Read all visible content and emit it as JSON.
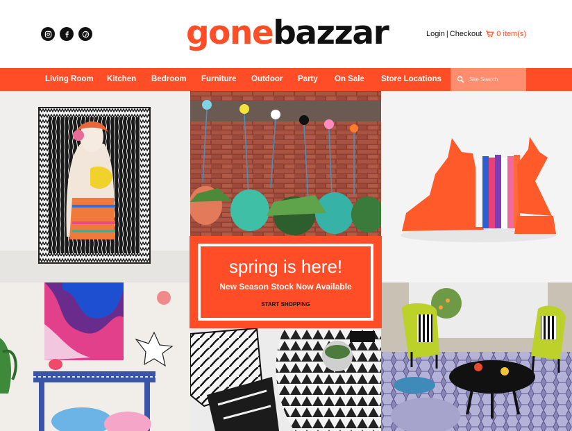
{
  "header": {
    "social": [
      {
        "name": "instagram-icon"
      },
      {
        "name": "facebook-icon"
      },
      {
        "name": "pinterest-icon"
      }
    ],
    "logo_part1": "gone",
    "logo_part2": "bazzar",
    "login_label": "Login",
    "separator": "|",
    "checkout_label": "Checkout",
    "cart_label": "0 item(s)"
  },
  "nav": {
    "items": [
      "Living Room",
      "Kitchen",
      "Bedroom",
      "Furniture",
      "Outdoor",
      "Party",
      "On Sale",
      "Store Locations"
    ],
    "search_placeholder": "Site Search"
  },
  "promo": {
    "title": "spring is here!",
    "subtitle": "New Season Stock Now Available",
    "cta": "START SHOPPING"
  },
  "colors": {
    "accent": "#ff4e27",
    "search_bg": "#ff8d6f",
    "text": "#111111"
  }
}
